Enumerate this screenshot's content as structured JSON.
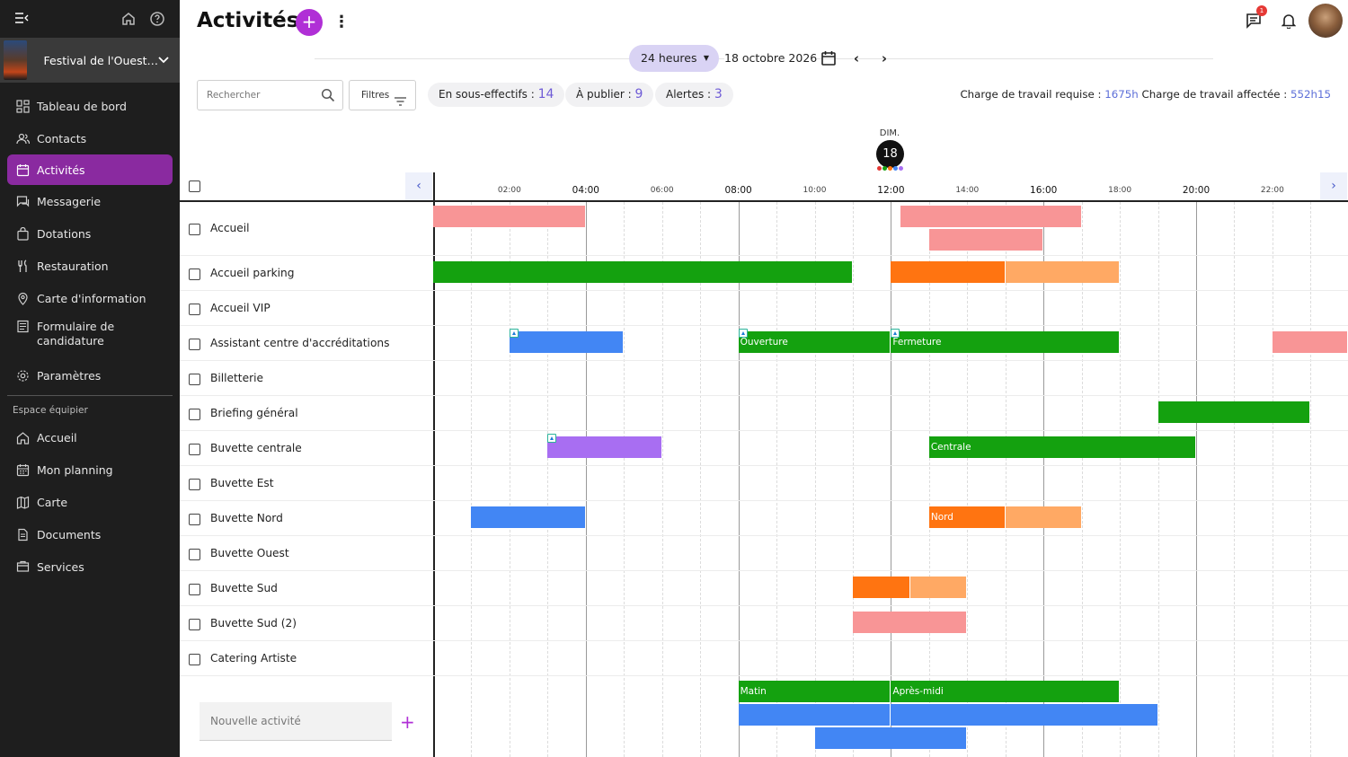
{
  "sidebar": {
    "event_name": "Festival de l'Ouest…",
    "items": [
      {
        "label": "Tableau de bord",
        "icon": "dashboard-icon",
        "active": false
      },
      {
        "label": "Contacts",
        "icon": "contacts-icon",
        "active": false
      },
      {
        "label": "Activités",
        "icon": "calendar-icon",
        "active": true
      },
      {
        "label": "Messagerie",
        "icon": "chat-icon",
        "active": false
      },
      {
        "label": "Dotations",
        "icon": "bag-icon",
        "active": false
      },
      {
        "label": "Restauration",
        "icon": "utensils-icon",
        "active": false
      },
      {
        "label": "Carte d'information",
        "icon": "pin-icon",
        "active": false
      },
      {
        "label": "Formulaire de candidature",
        "icon": "form-icon",
        "active": false
      },
      {
        "label": "Paramètres",
        "icon": "gear-icon",
        "active": false
      }
    ],
    "section_label": "Espace équipier",
    "team_items": [
      {
        "label": "Accueil",
        "icon": "home-icon"
      },
      {
        "label": "Mon planning",
        "icon": "calendar-icon"
      },
      {
        "label": "Carte",
        "icon": "map-icon"
      },
      {
        "label": "Documents",
        "icon": "document-icon"
      },
      {
        "label": "Services",
        "icon": "services-icon"
      }
    ]
  },
  "header": {
    "title": "Activités",
    "add_label": "+",
    "notification_count": "1"
  },
  "datebar": {
    "range": "24 heures",
    "date": "18 octobre 2026"
  },
  "toolbar": {
    "search_placeholder": "Rechercher",
    "filters_label": "Filtres",
    "chips": [
      {
        "label": "En sous-effectifs : ",
        "value": "14"
      },
      {
        "label": "À publier : ",
        "value": "9"
      },
      {
        "label": "Alertes : ",
        "value": "3"
      }
    ],
    "charge_required_label": "Charge de travail requise : ",
    "charge_required_value": "1675h",
    "charge_assigned_label": " Charge de travail affectée : ",
    "charge_assigned_value": "552h15"
  },
  "day": {
    "label": "DIM.",
    "number": "18"
  },
  "timeline": {
    "ticks": [
      {
        "label": "02:00",
        "major": false
      },
      {
        "label": "04:00",
        "major": true
      },
      {
        "label": "06:00",
        "major": false
      },
      {
        "label": "08:00",
        "major": true
      },
      {
        "label": "10:00",
        "major": false
      },
      {
        "label": "12:00",
        "major": true
      },
      {
        "label": "14:00",
        "major": false
      },
      {
        "label": "16:00",
        "major": true
      },
      {
        "label": "18:00",
        "major": false
      },
      {
        "label": "20:00",
        "major": true
      },
      {
        "label": "22:00",
        "major": false
      }
    ]
  },
  "activities": [
    "Accueil",
    "Accueil parking",
    "Accueil VIP",
    "Assistant centre d'accréditations",
    "Billetterie",
    "Briefing général",
    "Buvette centrale",
    "Buvette Est",
    "Buvette Nord",
    "Buvette Ouest",
    "Buvette Sud",
    "Buvette Sud (2)",
    "Catering Artiste"
  ],
  "shifts": [
    {
      "row": 0,
      "lane": 0,
      "start": 0,
      "end": 4,
      "color": "pink",
      "label": ""
    },
    {
      "row": 0,
      "lane": 0,
      "start": 12.25,
      "end": 17,
      "color": "pink",
      "label": ""
    },
    {
      "row": 0,
      "lane": 1,
      "start": 13,
      "end": 16,
      "color": "pink",
      "label": ""
    },
    {
      "row": 1,
      "lane": 0,
      "start": 0,
      "end": 11,
      "color": "green",
      "label": ""
    },
    {
      "row": 1,
      "lane": 0,
      "start": 12,
      "end": 15,
      "color": "orange",
      "label": ""
    },
    {
      "row": 1,
      "lane": 0,
      "start": 15,
      "end": 18,
      "color": "orange-light",
      "label": ""
    },
    {
      "row": 3,
      "lane": 0,
      "start": 2,
      "end": 5,
      "color": "blue",
      "label": "",
      "publish": true
    },
    {
      "row": 3,
      "lane": 0,
      "start": 8,
      "end": 12,
      "color": "green",
      "label": "Ouverture",
      "publish": true
    },
    {
      "row": 3,
      "lane": 0,
      "start": 12,
      "end": 18,
      "color": "green",
      "label": "Fermeture",
      "publish": true
    },
    {
      "row": 3,
      "lane": 0,
      "start": 22,
      "end": 24,
      "color": "pink",
      "label": ""
    },
    {
      "row": 5,
      "lane": 0,
      "start": 19,
      "end": 23,
      "color": "green",
      "label": ""
    },
    {
      "row": 6,
      "lane": 0,
      "start": 3,
      "end": 6,
      "color": "purple",
      "label": "",
      "publish": true
    },
    {
      "row": 6,
      "lane": 0,
      "start": 13,
      "end": 20,
      "color": "green",
      "label": "Centrale"
    },
    {
      "row": 8,
      "lane": 0,
      "start": 1,
      "end": 4,
      "color": "blue",
      "label": ""
    },
    {
      "row": 8,
      "lane": 0,
      "start": 13,
      "end": 15,
      "color": "orange",
      "label": "Nord"
    },
    {
      "row": 8,
      "lane": 0,
      "start": 15,
      "end": 17,
      "color": "orange-light",
      "label": ""
    },
    {
      "row": 10,
      "lane": 0,
      "start": 11,
      "end": 12.5,
      "color": "orange",
      "label": ""
    },
    {
      "row": 10,
      "lane": 0,
      "start": 12.5,
      "end": 14,
      "color": "orange-light",
      "label": ""
    },
    {
      "row": 11,
      "lane": 0,
      "start": 11,
      "end": 14,
      "color": "pink",
      "label": ""
    },
    {
      "row": 13,
      "lane": 0,
      "start": 8,
      "end": 12,
      "color": "green",
      "label": "Matin"
    },
    {
      "row": 13,
      "lane": 0,
      "start": 12,
      "end": 18,
      "color": "green",
      "label": "Après-midi"
    },
    {
      "row": 13,
      "lane": 1,
      "start": 8,
      "end": 12,
      "color": "blue",
      "label": ""
    },
    {
      "row": 13,
      "lane": 1,
      "start": 12,
      "end": 19,
      "color": "blue",
      "label": ""
    },
    {
      "row": 13,
      "lane": 2,
      "start": 10,
      "end": 14,
      "color": "blue",
      "label": ""
    }
  ],
  "new_activity": {
    "placeholder": "Nouvelle activité",
    "add_label": "+"
  },
  "colors": {
    "accent": "#b02fd6",
    "sidebar_active": "#8a2aa0",
    "chip_value": "#6e5bd6"
  }
}
